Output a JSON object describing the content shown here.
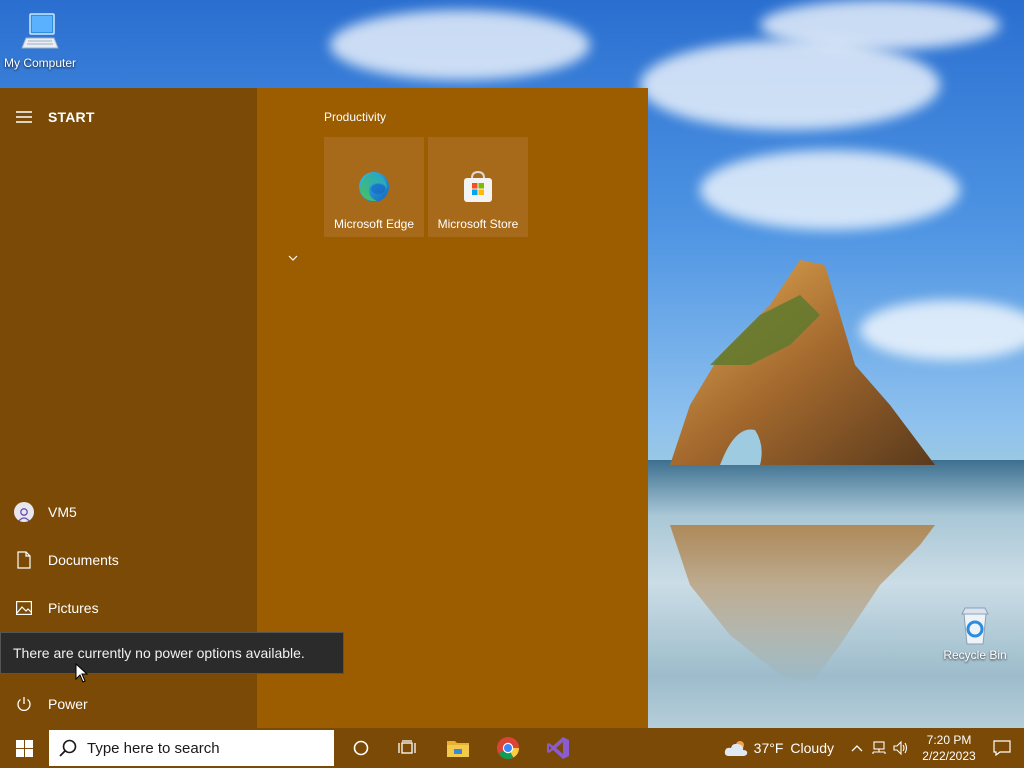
{
  "desktop": {
    "icons": [
      {
        "label": "My Computer"
      },
      {
        "label": "Recycle Bin"
      }
    ]
  },
  "start_menu": {
    "title": "START",
    "user": {
      "name": "VM5"
    },
    "places": [
      {
        "label": "Documents",
        "icon": "document-icon"
      },
      {
        "label": "Pictures",
        "icon": "pictures-icon"
      }
    ],
    "power": {
      "label": "Power",
      "icon": "power-icon"
    },
    "group": {
      "title": "Productivity",
      "tiles": [
        {
          "label": "Microsoft Edge",
          "icon": "edge-icon"
        },
        {
          "label": "Microsoft Store",
          "icon": "store-icon"
        }
      ]
    }
  },
  "tooltip": {
    "text": "There are currently no power options available."
  },
  "taskbar": {
    "search_placeholder": "Type here to search",
    "apps": [
      "cortana-icon",
      "task-view-icon",
      "file-explorer-icon",
      "chrome-icon",
      "visual-studio-icon"
    ],
    "weather": {
      "temp": "37°F",
      "condition": "Cloudy"
    },
    "clock": {
      "time": "7:20 PM",
      "date": "2/22/2023"
    }
  },
  "colors": {
    "accent_dark": "#7a4a06",
    "accent": "#9c5d00",
    "tile": "#a76a1a"
  }
}
